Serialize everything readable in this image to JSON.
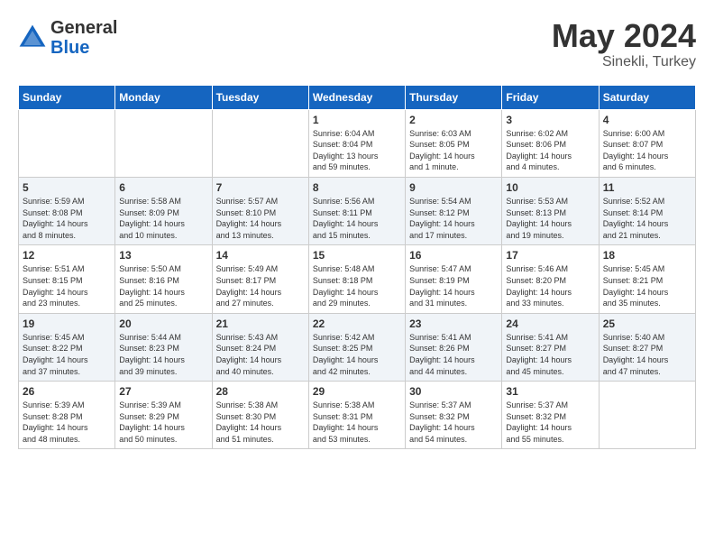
{
  "header": {
    "logo_general": "General",
    "logo_blue": "Blue",
    "month_year": "May 2024",
    "location": "Sinekli, Turkey"
  },
  "weekdays": [
    "Sunday",
    "Monday",
    "Tuesday",
    "Wednesday",
    "Thursday",
    "Friday",
    "Saturday"
  ],
  "weeks": [
    [
      {
        "day": "",
        "info": ""
      },
      {
        "day": "",
        "info": ""
      },
      {
        "day": "",
        "info": ""
      },
      {
        "day": "1",
        "info": "Sunrise: 6:04 AM\nSunset: 8:04 PM\nDaylight: 13 hours\nand 59 minutes."
      },
      {
        "day": "2",
        "info": "Sunrise: 6:03 AM\nSunset: 8:05 PM\nDaylight: 14 hours\nand 1 minute."
      },
      {
        "day": "3",
        "info": "Sunrise: 6:02 AM\nSunset: 8:06 PM\nDaylight: 14 hours\nand 4 minutes."
      },
      {
        "day": "4",
        "info": "Sunrise: 6:00 AM\nSunset: 8:07 PM\nDaylight: 14 hours\nand 6 minutes."
      }
    ],
    [
      {
        "day": "5",
        "info": "Sunrise: 5:59 AM\nSunset: 8:08 PM\nDaylight: 14 hours\nand 8 minutes."
      },
      {
        "day": "6",
        "info": "Sunrise: 5:58 AM\nSunset: 8:09 PM\nDaylight: 14 hours\nand 10 minutes."
      },
      {
        "day": "7",
        "info": "Sunrise: 5:57 AM\nSunset: 8:10 PM\nDaylight: 14 hours\nand 13 minutes."
      },
      {
        "day": "8",
        "info": "Sunrise: 5:56 AM\nSunset: 8:11 PM\nDaylight: 14 hours\nand 15 minutes."
      },
      {
        "day": "9",
        "info": "Sunrise: 5:54 AM\nSunset: 8:12 PM\nDaylight: 14 hours\nand 17 minutes."
      },
      {
        "day": "10",
        "info": "Sunrise: 5:53 AM\nSunset: 8:13 PM\nDaylight: 14 hours\nand 19 minutes."
      },
      {
        "day": "11",
        "info": "Sunrise: 5:52 AM\nSunset: 8:14 PM\nDaylight: 14 hours\nand 21 minutes."
      }
    ],
    [
      {
        "day": "12",
        "info": "Sunrise: 5:51 AM\nSunset: 8:15 PM\nDaylight: 14 hours\nand 23 minutes."
      },
      {
        "day": "13",
        "info": "Sunrise: 5:50 AM\nSunset: 8:16 PM\nDaylight: 14 hours\nand 25 minutes."
      },
      {
        "day": "14",
        "info": "Sunrise: 5:49 AM\nSunset: 8:17 PM\nDaylight: 14 hours\nand 27 minutes."
      },
      {
        "day": "15",
        "info": "Sunrise: 5:48 AM\nSunset: 8:18 PM\nDaylight: 14 hours\nand 29 minutes."
      },
      {
        "day": "16",
        "info": "Sunrise: 5:47 AM\nSunset: 8:19 PM\nDaylight: 14 hours\nand 31 minutes."
      },
      {
        "day": "17",
        "info": "Sunrise: 5:46 AM\nSunset: 8:20 PM\nDaylight: 14 hours\nand 33 minutes."
      },
      {
        "day": "18",
        "info": "Sunrise: 5:45 AM\nSunset: 8:21 PM\nDaylight: 14 hours\nand 35 minutes."
      }
    ],
    [
      {
        "day": "19",
        "info": "Sunrise: 5:45 AM\nSunset: 8:22 PM\nDaylight: 14 hours\nand 37 minutes."
      },
      {
        "day": "20",
        "info": "Sunrise: 5:44 AM\nSunset: 8:23 PM\nDaylight: 14 hours\nand 39 minutes."
      },
      {
        "day": "21",
        "info": "Sunrise: 5:43 AM\nSunset: 8:24 PM\nDaylight: 14 hours\nand 40 minutes."
      },
      {
        "day": "22",
        "info": "Sunrise: 5:42 AM\nSunset: 8:25 PM\nDaylight: 14 hours\nand 42 minutes."
      },
      {
        "day": "23",
        "info": "Sunrise: 5:41 AM\nSunset: 8:26 PM\nDaylight: 14 hours\nand 44 minutes."
      },
      {
        "day": "24",
        "info": "Sunrise: 5:41 AM\nSunset: 8:27 PM\nDaylight: 14 hours\nand 45 minutes."
      },
      {
        "day": "25",
        "info": "Sunrise: 5:40 AM\nSunset: 8:27 PM\nDaylight: 14 hours\nand 47 minutes."
      }
    ],
    [
      {
        "day": "26",
        "info": "Sunrise: 5:39 AM\nSunset: 8:28 PM\nDaylight: 14 hours\nand 48 minutes."
      },
      {
        "day": "27",
        "info": "Sunrise: 5:39 AM\nSunset: 8:29 PM\nDaylight: 14 hours\nand 50 minutes."
      },
      {
        "day": "28",
        "info": "Sunrise: 5:38 AM\nSunset: 8:30 PM\nDaylight: 14 hours\nand 51 minutes."
      },
      {
        "day": "29",
        "info": "Sunrise: 5:38 AM\nSunset: 8:31 PM\nDaylight: 14 hours\nand 53 minutes."
      },
      {
        "day": "30",
        "info": "Sunrise: 5:37 AM\nSunset: 8:32 PM\nDaylight: 14 hours\nand 54 minutes."
      },
      {
        "day": "31",
        "info": "Sunrise: 5:37 AM\nSunset: 8:32 PM\nDaylight: 14 hours\nand 55 minutes."
      },
      {
        "day": "",
        "info": ""
      }
    ]
  ]
}
